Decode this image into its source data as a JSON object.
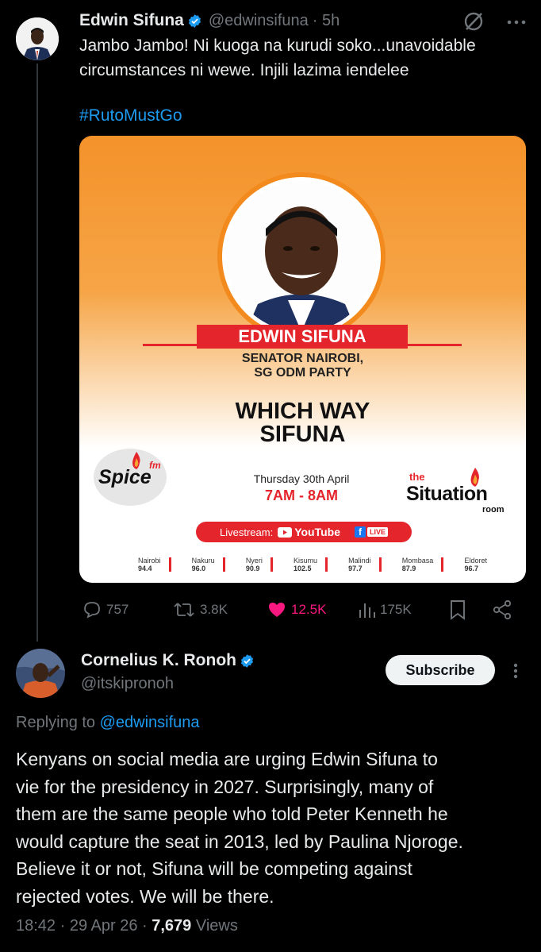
{
  "tweet": {
    "author_name": "Edwin Sifuna",
    "handle": "@edwinsifuna",
    "time": "· 5h",
    "text_line1": "Jambo Jambo! Ni kuoga na kurudi soko...unavoidable",
    "text_line2": "circumstances ni wewe. Injili lazima iendelee",
    "hashtag": "#RutoMustGo",
    "poster": {
      "name": "EDWIN SIFUNA",
      "role_line1": "SENATOR NAIROBI,",
      "role_line2": "SG ODM PARTY",
      "headline_line1": "WHICH WAY",
      "headline_line2": "SIFUNA",
      "station_logo": "Spice",
      "station_fm": "fm",
      "date": "Thursday 30th April",
      "time": "7AM - 8AM",
      "show_the": "the",
      "show_name": "Situation",
      "show_room": "room",
      "livestream_label": "Livestream:",
      "youtube_label": "YouTube",
      "fb_live": "LIVE",
      "frequencies": [
        {
          "city": "Nairobi",
          "freq": "94.4"
        },
        {
          "city": "Nakuru",
          "freq": "96.0"
        },
        {
          "city": "Nyeri",
          "freq": "90.9"
        },
        {
          "city": "Kisumu",
          "freq": "102.5"
        },
        {
          "city": "Malindi",
          "freq": "97.7"
        },
        {
          "city": "Mombasa",
          "freq": "87.9"
        },
        {
          "city": "Eldoret",
          "freq": "96.7"
        }
      ]
    },
    "stats": {
      "replies": "757",
      "reposts": "3.8K",
      "likes": "12.5K",
      "views": "175K"
    }
  },
  "reply": {
    "author_name": "Cornelius K. Ronoh",
    "handle": "@itskipronoh",
    "subscribe_label": "Subscribe",
    "replying_prefix": "Replying to",
    "replying_handle": "@edwinsifuna",
    "text_lines": [
      "Kenyans on social media are urging Edwin Sifuna to",
      "vie for the presidency in 2027. Surprisingly, many of",
      "them are the same people who told Peter Kenneth he",
      "would capture the seat in 2013, led by Paulina Njoroge.",
      "Believe it or not, Sifuna will be competing against",
      "rejected votes. We will be there."
    ],
    "timestamp": "18:42 · 29 Apr 26 ·",
    "views_count": "7,679",
    "views_label": "Views"
  },
  "colors": {
    "accent": "#1d9bf0",
    "like": "#f91880",
    "poster_orange": "#f4922a",
    "poster_red": "#e4252c"
  }
}
